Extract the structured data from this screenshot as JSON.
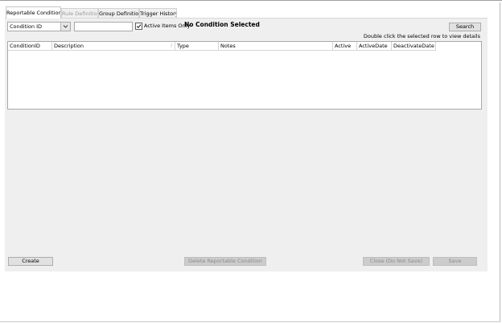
{
  "tabs": [
    {
      "label": "Reportable Conditions",
      "state": "active"
    },
    {
      "label": "Rule Definition",
      "state": "disabled"
    },
    {
      "label": "Group Definition",
      "state": "normal"
    },
    {
      "label": "Trigger History",
      "state": "normal"
    }
  ],
  "filter": {
    "field_select": "Condition ID",
    "search_value": "",
    "active_only_label": "Active Items Only",
    "active_only_checked": true
  },
  "status_text": "No Condition Selected",
  "search_button": "Search",
  "hint_text": "Double click the selected row to view details",
  "grid": {
    "columns": [
      "ConditionID",
      "Description",
      "Type",
      "Notes",
      "Active",
      "ActiveDate",
      "DeactivateDate"
    ],
    "rows": []
  },
  "buttons": {
    "create": "Create",
    "delete": "Delete Reportable Condition",
    "close": "Close (Do Not Save)",
    "save": "Save"
  },
  "icons": {
    "dropdown": "chevron-down-icon",
    "checkbox": "checkmark-icon",
    "sort": "sort-indicator-icon"
  }
}
